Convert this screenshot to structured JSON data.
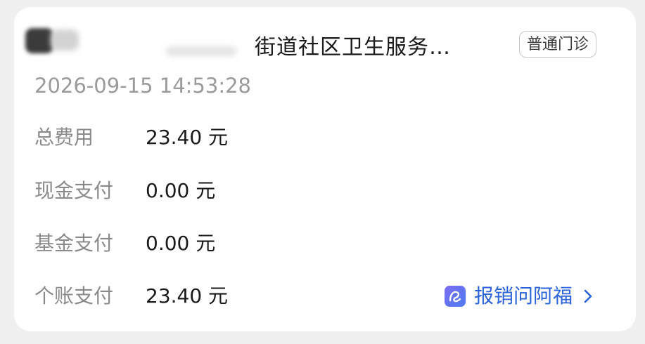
{
  "record": {
    "institution": "街道社区卫生服务…",
    "visit_type": "普通门诊",
    "datetime": "2026-09-15 14:53:28"
  },
  "fees": [
    {
      "label": "总费用",
      "value": "23.40 元"
    },
    {
      "label": "现金支付",
      "value": "0.00 元"
    },
    {
      "label": "基金支付",
      "value": "0.00 元"
    },
    {
      "label": "个账支付",
      "value": "23.40 元"
    }
  ],
  "assistant": {
    "label": "报销问阿福",
    "icon": "ai-assistant-icon",
    "arrow_icon": "chevron-right-icon"
  },
  "colors": {
    "link": "#2a63d8",
    "icon_gradient_start": "#7b6cf0",
    "icon_gradient_end": "#4f7bf2"
  }
}
